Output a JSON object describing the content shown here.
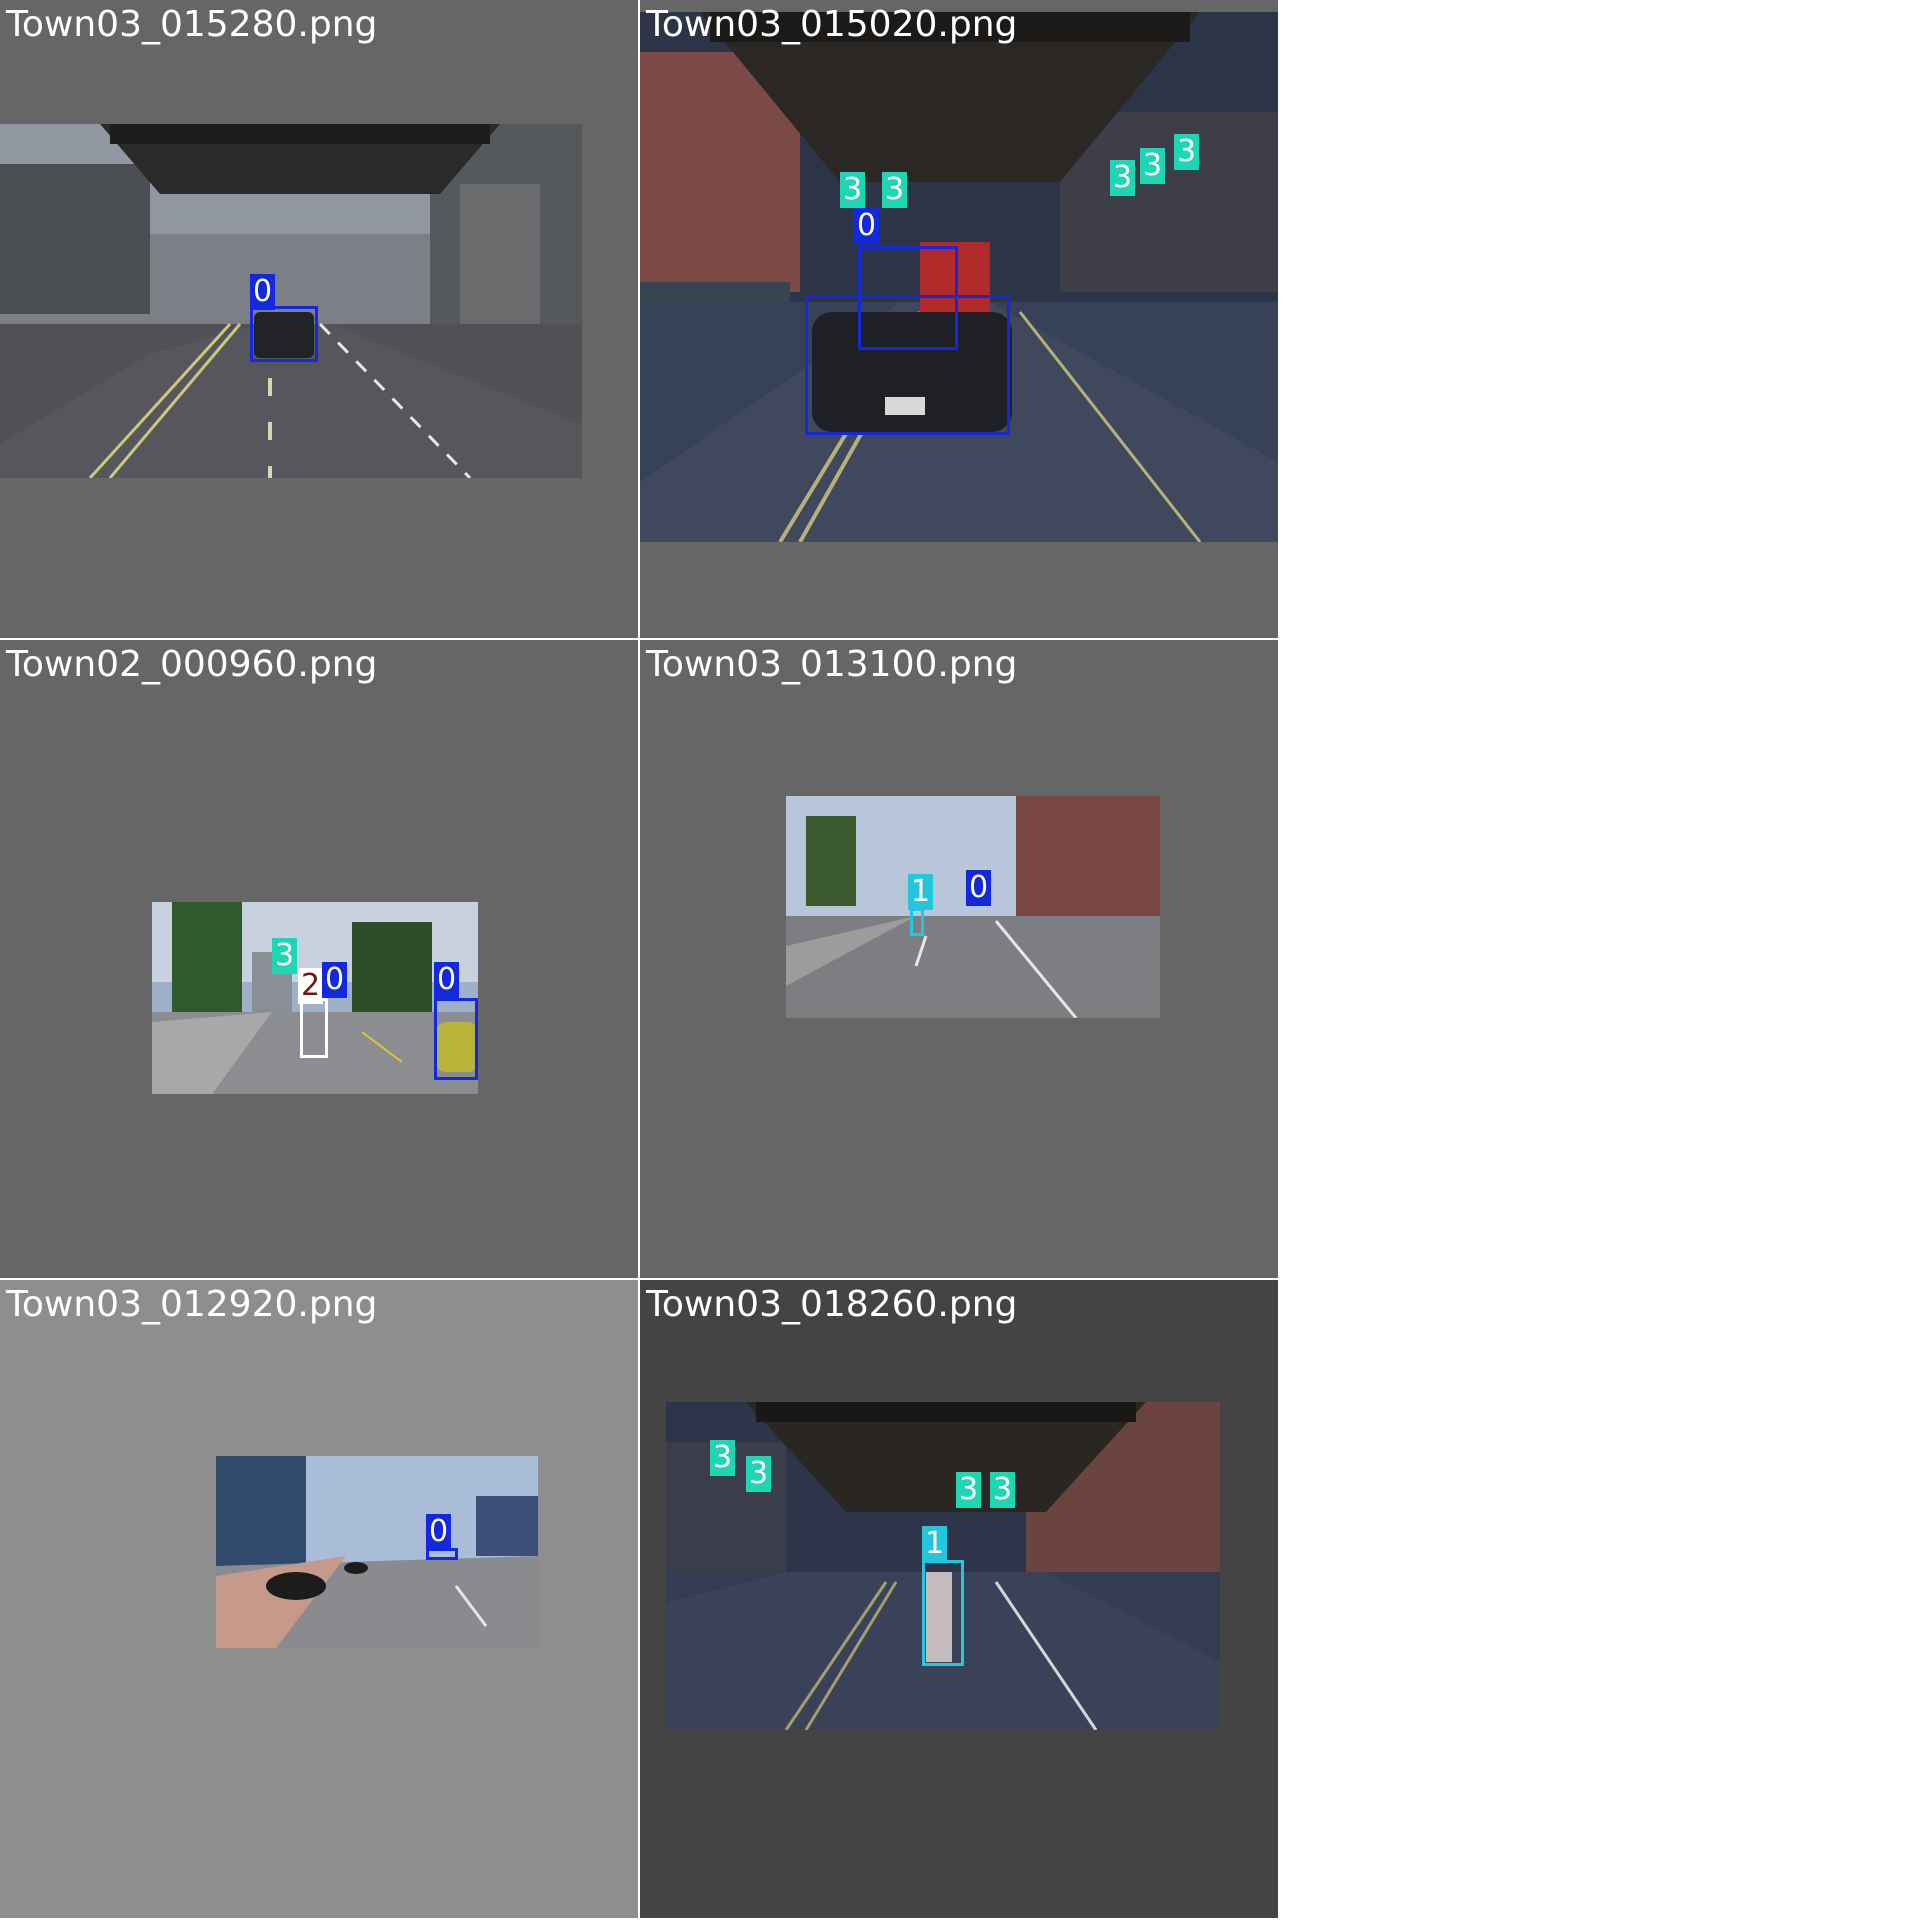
{
  "class_colors": {
    "0": "#1428e0",
    "1": "#22c7dd",
    "2": "#ffffff",
    "3": "#1ed6b4"
  },
  "tiles": [
    {
      "filename": "Town03_015280.png",
      "background": "#666666",
      "scene": "city street under elevated rail",
      "detections": [
        {
          "label": "0"
        }
      ]
    },
    {
      "filename": "Town03_015020.png",
      "background": "#666666",
      "scene": "night street under elevated rail with car ahead",
      "detections": [
        {
          "label": "0"
        },
        {
          "label": "0"
        },
        {
          "label": "3"
        },
        {
          "label": "3"
        },
        {
          "label": "3"
        },
        {
          "label": "3"
        },
        {
          "label": "3"
        }
      ]
    },
    {
      "filename": "Town02_000960.png",
      "background": "#666666",
      "scene": "suburban street with trees",
      "detections": [
        {
          "label": "3"
        },
        {
          "label": "2"
        },
        {
          "label": "0"
        },
        {
          "label": "0"
        }
      ]
    },
    {
      "filename": "Town03_013100.png",
      "background": "#666666",
      "scene": "road with brick buildings",
      "detections": [
        {
          "label": "1"
        },
        {
          "label": "0"
        }
      ]
    },
    {
      "filename": "Town03_012920.png",
      "background": "#8e8e8e",
      "scene": "plaza road with planters",
      "detections": [
        {
          "label": "0"
        }
      ]
    },
    {
      "filename": "Town03_018260.png",
      "background": "#444444",
      "scene": "dark street under elevated rail with cyclist",
      "detections": [
        {
          "label": "3"
        },
        {
          "label": "3"
        },
        {
          "label": "3"
        },
        {
          "label": "3"
        },
        {
          "label": "1"
        }
      ]
    }
  ]
}
